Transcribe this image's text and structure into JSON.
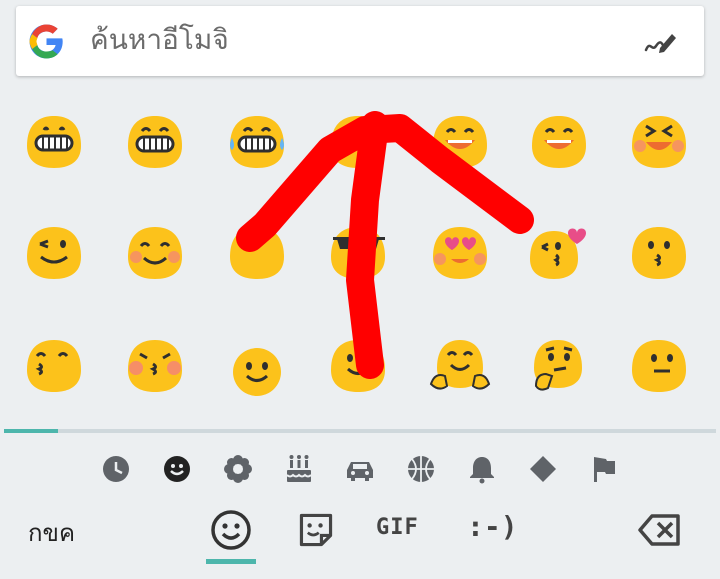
{
  "search": {
    "placeholder": "ค้นหาอีโมจิ"
  },
  "emoji_grid": {
    "rows": [
      [
        "grinning-face",
        "beaming-face",
        "face-with-tears-of-joy",
        "grinning-sweat",
        "smiling-eyes-sweat",
        "grinning-sweat",
        "laughing-squinting"
      ],
      [
        "winking-face",
        "smiling-blushing-face",
        "upside-down-face",
        "smiling-face-with-sunglasses",
        "heart-eyes-face",
        "face-blowing-kiss",
        "kissing-face"
      ],
      [
        "kissing-closed-eyes",
        "kissing-blushing-face",
        "slightly-smiling-face",
        "slightly-smiling-face-2",
        "hugging-face",
        "thinking-face",
        "neutral-face"
      ]
    ]
  },
  "categories": {
    "items": [
      "recent-clock-icon",
      "smiley-icon",
      "flower-icon",
      "cake-icon",
      "car-icon",
      "basketball-icon",
      "bell-icon",
      "diamond-icon",
      "flag-icon"
    ],
    "active": "smiley-icon"
  },
  "bottom_bar": {
    "abc_label": "กขค",
    "gif_label": "GIF",
    "emoticon_label": ":-)",
    "active_tab": "emoji"
  },
  "colors": {
    "background": "#eceff1",
    "accent": "#4db6ac",
    "emoji_yellow": "#fcc21b",
    "overlay_arrow": "#ff0000"
  }
}
